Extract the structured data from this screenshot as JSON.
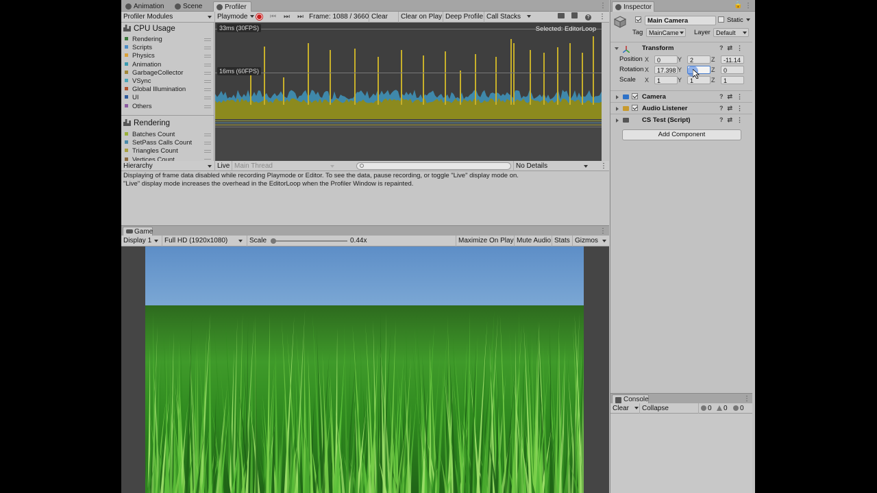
{
  "tabs": {
    "animation": "Animation",
    "scene": "Scene",
    "profiler": "Profiler"
  },
  "profiler_toolbar": {
    "modules_label": "Profiler Modules",
    "playmode": "Playmode",
    "frame": "Frame: 1088 / 3660",
    "clear": "Clear",
    "clear_on_play": "Clear on Play",
    "deep_profile": "Deep Profile",
    "call_stacks": "Call Stacks"
  },
  "cpu_module": {
    "title": "CPU Usage",
    "items": [
      {
        "label": "Rendering",
        "color": "#3c7a3c"
      },
      {
        "label": "Scripts",
        "color": "#4b8cc4"
      },
      {
        "label": "Physics",
        "color": "#d9a03a"
      },
      {
        "label": "Animation",
        "color": "#3a9ab0"
      },
      {
        "label": "GarbageCollector",
        "color": "#a0883a"
      },
      {
        "label": "VSync",
        "color": "#4aa6b8"
      },
      {
        "label": "Global Illumination",
        "color": "#b0542e"
      },
      {
        "label": "UI",
        "color": "#2e5a9a"
      },
      {
        "label": "Others",
        "color": "#8a5aa0"
      }
    ]
  },
  "rendering_module": {
    "title": "Rendering",
    "items": [
      {
        "label": "Batches Count",
        "color": "#9ab03a"
      },
      {
        "label": "SetPass Calls Count",
        "color": "#4a8aa8"
      },
      {
        "label": "Triangles Count",
        "color": "#a8a040"
      },
      {
        "label": "Vertices Count",
        "color": "#8a6a40"
      }
    ]
  },
  "graph": {
    "label_33ms": "33ms (30FPS)",
    "label_16ms": "16ms (60FPS)",
    "selected": "Selected: EditorLoop",
    "spike_color": "#c8b02a",
    "base_color": "#8c8a1e",
    "blue_color": "#3f88aa"
  },
  "hierarchy_bar": {
    "hierarchy": "Hierarchy",
    "live": "Live",
    "main_thread": "Main Thread",
    "no_details": "No Details"
  },
  "message": {
    "line1": "Displaying of frame data disabled while recording Playmode or Editor. To see the data, pause recording, or toggle \"Live\" display mode on.",
    "line2": "\"Live\" display mode increases the overhead in the EditorLoop when the Profiler Window is repainted."
  },
  "game": {
    "tab": "Game",
    "display": "Display 1",
    "resolution": "Full HD (1920x1080)",
    "scale_label": "Scale",
    "scale_value": "0.44x",
    "maximize": "Maximize On Play",
    "mute": "Mute Audio",
    "stats": "Stats",
    "gizmos": "Gizmos",
    "scale_fraction": 0.0
  },
  "inspector": {
    "tab": "Inspector",
    "object_name": "Main Camera",
    "static_label": "Static",
    "tag_label": "Tag",
    "tag_value": "MainCame",
    "layer_label": "Layer",
    "layer_value": "Default",
    "transform": {
      "title": "Transform",
      "position_label": "Position",
      "rotation_label": "Rotation",
      "scale_label": "Scale",
      "x": "X",
      "y": "Y",
      "z": "Z",
      "position": {
        "x": "0",
        "y": "2",
        "z": "-11.14"
      },
      "rotation": {
        "x": "17.398",
        "y": "",
        "z": "0"
      },
      "scale": {
        "x": "1",
        "y": "1",
        "z": "1"
      }
    },
    "components": [
      {
        "name": "Camera",
        "icon": "camera-icon",
        "color": "#2e72c8"
      },
      {
        "name": "Audio Listener",
        "icon": "audio-listener-icon",
        "color": "#c89a2e"
      },
      {
        "name": "CS Test (Script)",
        "icon": "script-icon",
        "color": "#555555"
      }
    ],
    "add_component": "Add Component"
  },
  "console": {
    "tab": "Console",
    "clear": "Clear",
    "collapse": "Collapse",
    "info_count": "0",
    "warn_count": "0",
    "error_count": "0"
  }
}
